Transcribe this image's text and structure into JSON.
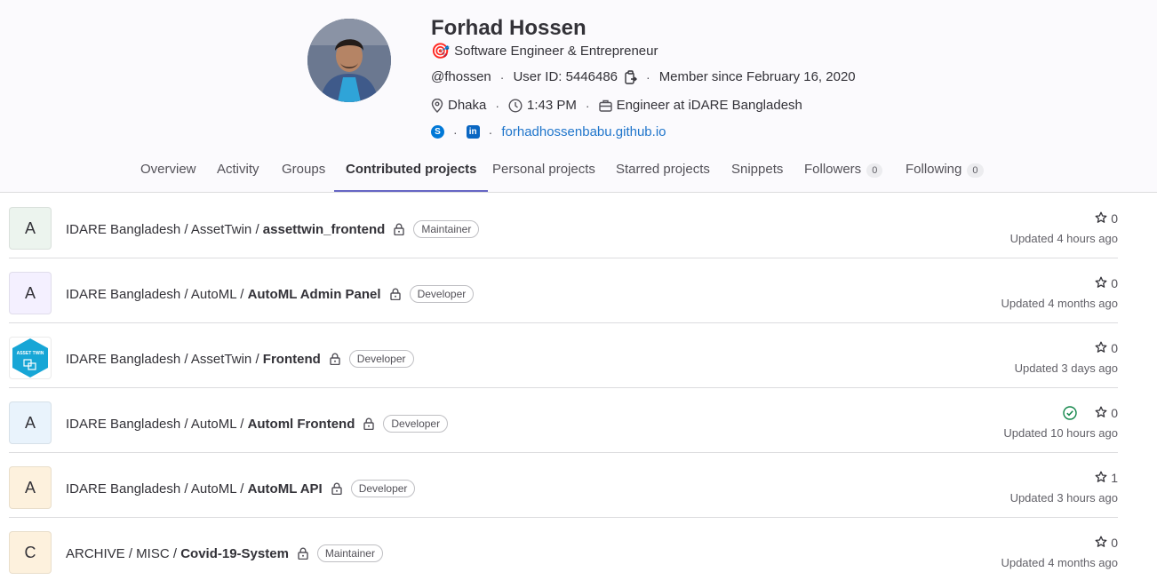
{
  "profile": {
    "name": "Forhad Hossen",
    "bio_emoji": "🎯",
    "bio": "Software Engineer & Entrepreneur",
    "username": "@fhossen",
    "user_id": "User ID: 5446486",
    "member_since": "Member since February 16, 2020",
    "location": "Dhaka",
    "local_time": "1:43 PM",
    "job": "Engineer at iDARE Bangladesh",
    "website": "forhadhossenbabu.github.io",
    "skype_glyph": "S",
    "linkedin_glyph": "in"
  },
  "tabs": [
    {
      "label": "Overview"
    },
    {
      "label": "Activity"
    },
    {
      "label": "Groups"
    },
    {
      "label": "Contributed projects"
    },
    {
      "label": "Personal projects"
    },
    {
      "label": "Starred projects"
    },
    {
      "label": "Snippets"
    },
    {
      "label": "Followers",
      "count": "0"
    },
    {
      "label": "Following",
      "count": "0"
    }
  ],
  "active_tab": "Contributed projects",
  "projects": [
    {
      "letter": "A",
      "avatar_bg": "#ecf4ee",
      "path": "IDARE Bangladesh / AssetTwin / ",
      "name": "assettwin_frontend",
      "role": "Maintainer",
      "stars": "0",
      "updated": "Updated 4 hours ago"
    },
    {
      "letter": "A",
      "avatar_bg": "#f4f0ff",
      "path": "IDARE Bangladesh / AutoML / ",
      "name": "AutoML Admin Panel",
      "role": "Developer",
      "stars": "0",
      "updated": "Updated 4 months ago"
    },
    {
      "letter": "",
      "avatar_bg": "#ffffff",
      "logo_text": "ASSET TWIN",
      "path": "IDARE Bangladesh / AssetTwin / ",
      "name": "Frontend",
      "role": "Developer",
      "stars": "0",
      "updated": "Updated 3 days ago"
    },
    {
      "letter": "A",
      "avatar_bg": "#e9f3fc",
      "path": "IDARE Bangladesh / AutoML / ",
      "name": "Automl Frontend",
      "role": "Developer",
      "stars": "0",
      "updated": "Updated 10 hours ago",
      "pipeline": "passed"
    },
    {
      "letter": "A",
      "avatar_bg": "#fdf1dd",
      "path": "IDARE Bangladesh / AutoML / ",
      "name": "AutoML API",
      "role": "Developer",
      "stars": "1",
      "updated": "Updated 3 hours ago"
    },
    {
      "letter": "C",
      "avatar_bg": "#fdf1dd",
      "path": "ARCHIVE / MISC / ",
      "name": "Covid-19-System",
      "role": "Maintainer",
      "stars": "0",
      "updated": "Updated 4 months ago"
    }
  ],
  "colors": {
    "accent": "#6666c4",
    "link": "#1f75cb",
    "skype": "#0078d7",
    "linkedin": "#0a66c2",
    "pipeline_success": "#108548"
  }
}
